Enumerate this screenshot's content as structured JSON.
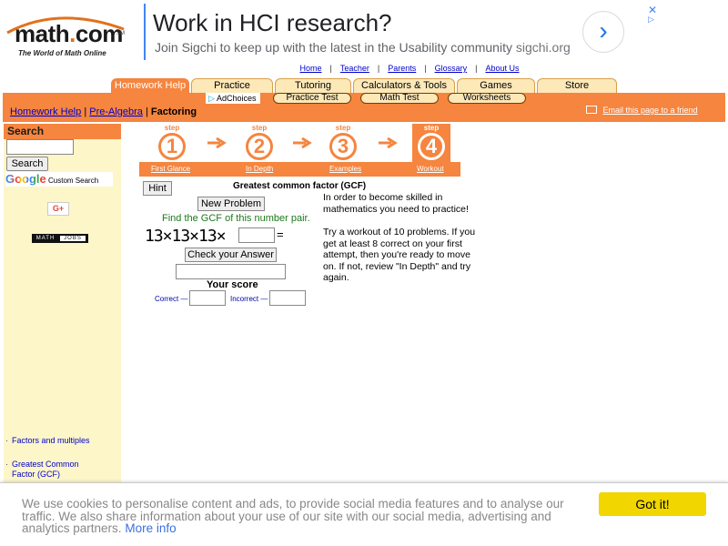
{
  "header": {
    "logo_word": "math",
    "logo_dot": ".",
    "logo_tld": "com",
    "logo_mark": "SM",
    "tagline": "The World of Math Online"
  },
  "ad": {
    "headline": "Work in HCI research?",
    "subline": "Join Sigchi to keep up with the latest in the Usability community",
    "domain": "sigchi.org",
    "arrow": "›",
    "close": "✕",
    "choices_mark": "▷"
  },
  "top_links": [
    "Home",
    "Teacher",
    "Parents",
    "Glossary",
    "About Us"
  ],
  "tabs": [
    "Homework Help",
    "Practice",
    "Tutoring",
    "Calculators & Tools",
    "Games",
    "Store"
  ],
  "subtabs": [
    "Practice Test",
    "Math Test",
    "Worksheets"
  ],
  "adchoices": {
    "icon": "▷",
    "label": "AdChoices"
  },
  "breadcrumb": {
    "items": [
      "Homework Help",
      "Pre-Algebra"
    ],
    "separator": "|",
    "current": "Factoring"
  },
  "email_link": "Email this page to a friend",
  "sidebar": {
    "search_title": "Search",
    "search_value": "",
    "search_button": "Search",
    "google": "Google",
    "custom_search": "Custom Search",
    "gplus": "G+",
    "mathjobs_left": "MATH",
    "mathjobs_right": "JOBS",
    "links": [
      "Factors and multiples",
      "Greatest Common Factor (GCF)"
    ]
  },
  "steps": {
    "label": "step",
    "items": [
      {
        "num": "1",
        "link": "First Glance"
      },
      {
        "num": "2",
        "link": "In Depth"
      },
      {
        "num": "3",
        "link": "Examples"
      },
      {
        "num": "4",
        "link": "Workout"
      }
    ],
    "active_index": 3
  },
  "workout": {
    "hint": "Hint",
    "title": "Greatest common factor (GCF)",
    "new_problem": "New Problem",
    "instruction": "Find the GCF of this number pair.",
    "problem": "13×13×13×",
    "equals": "=",
    "answer_value": "",
    "check_button": "Check your Answer",
    "feedback_value": "",
    "score_title": "Your score",
    "correct_label": "Correct —",
    "correct_value": "",
    "incorrect_label": "Incorrect —",
    "incorrect_value": ""
  },
  "info": {
    "para1": "In order to become skilled in mathematics you need to practice!",
    "para2": "Try a workout of 10 problems. If you get at least 8 correct on your first attempt, then you're ready to move on. If not, review \"In Depth\" and try again."
  },
  "cookie": {
    "text": "We use cookies to personalise content and ads, to provide social media features and to analyse our traffic. We also share information about your use of our site with our social media, advertising and analytics partners.",
    "more_info": "More info",
    "button": "Got it!"
  },
  "colors": {
    "accent_orange": "#f5853f",
    "tab_inactive": "#fde8b8",
    "sidebar_bg": "#fdf6c9",
    "link_blue": "#0000cc",
    "cookie_button": "#f1d600"
  }
}
